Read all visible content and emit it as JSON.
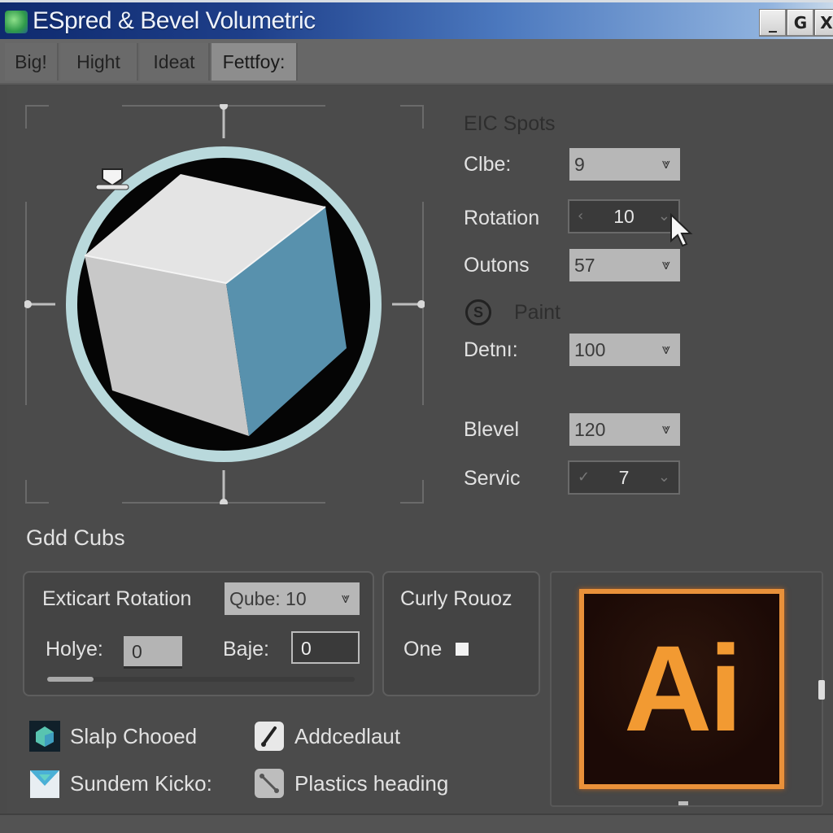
{
  "window": {
    "title": "ESpred & Bevel Volumetric",
    "icon": "app-icon",
    "controls": {
      "minimize": "_",
      "maximize": "G",
      "close": "X"
    }
  },
  "tabs": [
    {
      "label": "Big!",
      "active": false
    },
    {
      "label": "Hight",
      "active": false
    },
    {
      "label": "Ideat",
      "active": false
    },
    {
      "label": "Fettfoy:",
      "active": true
    }
  ],
  "preview": {
    "object": "cube",
    "colors": {
      "ring": "#b9d9dc",
      "background": "#050505",
      "cube_top": "#e4e4e4",
      "cube_left": "#c8c8c8",
      "cube_right": "#5891ad"
    }
  },
  "settings": {
    "heading": "EIC Spots",
    "fields": [
      {
        "label": "Clbe:",
        "value": "9",
        "type": "dropdown"
      },
      {
        "label": "Rotation",
        "value": "10",
        "type": "spinner"
      },
      {
        "label": "Outons",
        "value": "57",
        "type": "dropdown"
      }
    ],
    "paint": {
      "icon": "paint-icon",
      "label": "Paint"
    },
    "paint_fields": [
      {
        "label": "Detnı:",
        "value": "100",
        "type": "dropdown"
      },
      {
        "label": "Blevel",
        "value": "120",
        "type": "dropdown"
      },
      {
        "label": "Servic",
        "value": "7",
        "type": "spinner"
      }
    ]
  },
  "cubes_section": {
    "heading": "Gdd Cubs",
    "rotation_group": {
      "label": "Exticart Rotation",
      "select_value": "Qube: 10",
      "holye_label": "Holye:",
      "holye_value": "0",
      "baje_label": "Baje:",
      "baje_value": "0",
      "slider_value_percent": 15
    },
    "curly_group": {
      "label": "Curly Rouoz",
      "option_label": "One",
      "option_checked": false
    }
  },
  "logo": {
    "text": "Ai",
    "colors": {
      "border": "#e9913a",
      "text": "#f29a32",
      "background": "#1c0a06"
    }
  },
  "bottom_list": [
    {
      "icon": "cube-green-icon",
      "label": "Slalp Chooed"
    },
    {
      "icon": "brush-icon",
      "label": "Addcedlaut"
    },
    {
      "icon": "envelope-icon",
      "label": "Sundem Kicko:"
    },
    {
      "icon": "link-icon",
      "label": "Plastics heading"
    }
  ]
}
